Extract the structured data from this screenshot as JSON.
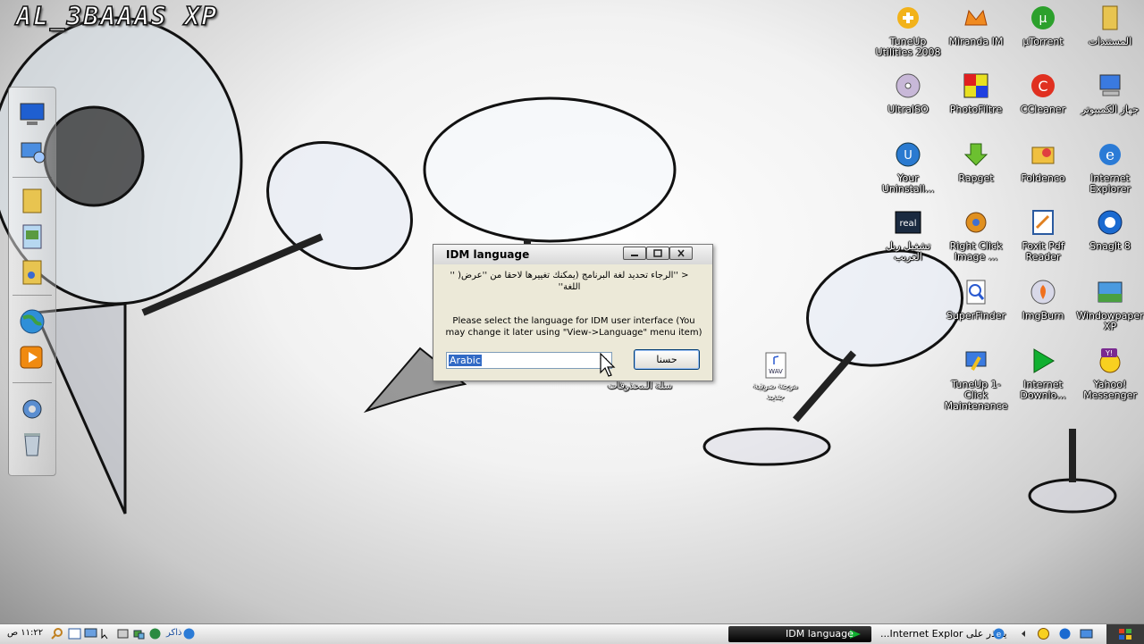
{
  "watermark": "AL_3BAAAS XP",
  "desktop_icons": [
    {
      "label": "TuneUp Utilities 2008",
      "icon": "tuneup-icon"
    },
    {
      "label": "Miranda IM",
      "icon": "miranda-icon"
    },
    {
      "label": "µTorrent",
      "icon": "utorrent-icon"
    },
    {
      "label": "المستندات",
      "icon": "documents-folder-icon"
    },
    {
      "label": "UltraISO",
      "icon": "ultraiso-icon"
    },
    {
      "label": "PhotoFiltre",
      "icon": "photofiltre-icon"
    },
    {
      "label": "CCleaner",
      "icon": "ccleaner-icon"
    },
    {
      "label": "جهاز الكمبيوتر",
      "icon": "my-computer-icon"
    },
    {
      "label": "Your Uninstall...",
      "icon": "your-uninstaller-icon"
    },
    {
      "label": "Rapget",
      "icon": "rapget-icon"
    },
    {
      "label": "Foldenco",
      "icon": "foldenco-icon"
    },
    {
      "label": "Internet Explorer",
      "icon": "internet-explorer-icon"
    },
    {
      "label": "تشغيل ريل الغريب",
      "icon": "real-player-icon"
    },
    {
      "label": "Right Click Image ...",
      "icon": "right-click-image-icon"
    },
    {
      "label": "Foxit Pdf Reader",
      "icon": "foxit-reader-icon"
    },
    {
      "label": "SnagIt 8",
      "icon": "snagit-icon"
    },
    {
      "label": "SuperFinder",
      "icon": "superfinder-icon"
    },
    {
      "label": "ImgBurn",
      "icon": "imgburn-icon"
    },
    {
      "label": "Windowpaper XP",
      "icon": "windowpaper-icon"
    },
    {
      "label": "TuneUp 1-Click Maintenance",
      "icon": "tuneup-maintenance-icon"
    },
    {
      "label": "Internet Downlo...",
      "icon": "idm-icon"
    },
    {
      "label": "Yahoo! Messenger",
      "icon": "yahoo-messenger-icon"
    }
  ],
  "desktop_file": {
    "label": "موجة صوتية جديد",
    "badge": "WAV"
  },
  "recycle_label": "سلة المحذوفات",
  "dialog": {
    "title": "IDM language",
    "arabic_text": "< ''الرجاء تحديد لغة البرنامج (يمكنك تغييرها لاحقا من ''عرض( '' اللغة''",
    "english_text": "Please select the language for IDM user interface (You may change it later using \"View->Language\" menu item)",
    "selected_language": "Arabic",
    "ok_label": "حسنا"
  },
  "taskbar": {
    "clock": "١١:٢٢ ص",
    "tray_label": "ذاكر",
    "active_task": "IDM language",
    "task2": "يتعذر على Internet Explor..."
  },
  "colors": {
    "dialog_bg": "#ece9d8",
    "selection": "#316ac5",
    "taskbar_active": "#000000"
  }
}
